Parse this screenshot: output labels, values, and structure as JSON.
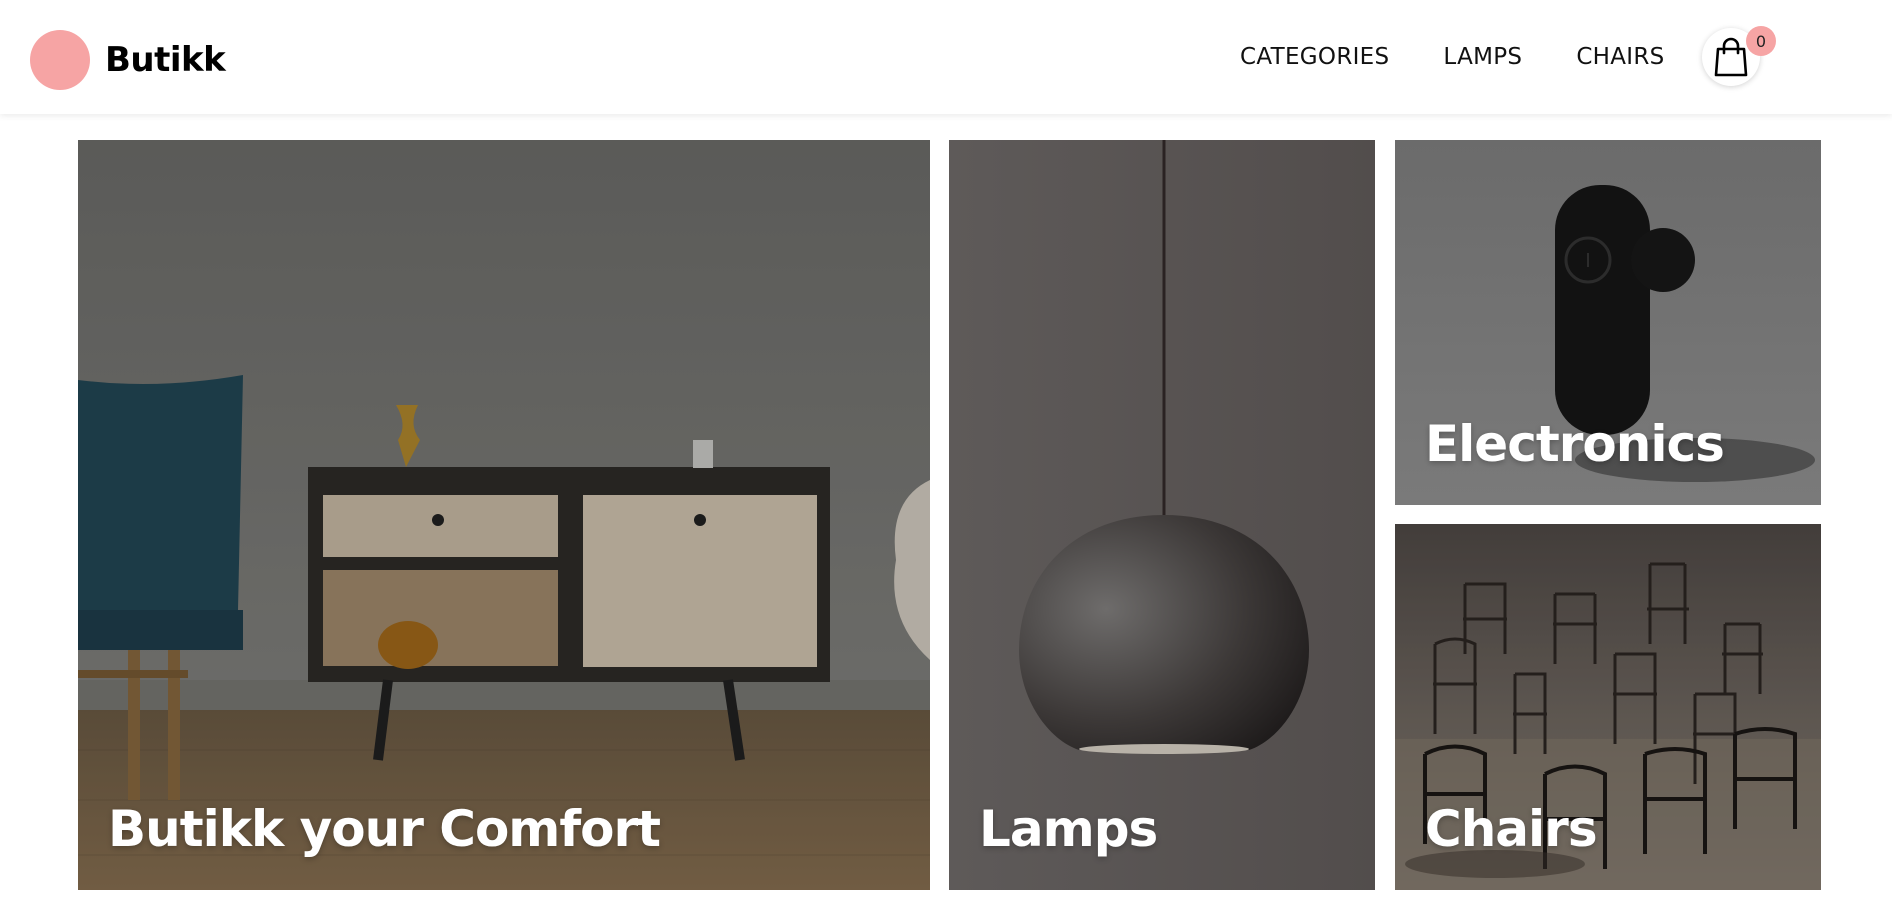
{
  "header": {
    "brand_name": "Butikk",
    "nav": [
      "CATEGORIES",
      "LAMPS",
      "CHAIRS"
    ],
    "cart_count": "0",
    "brand_color": "#f6a4a4"
  },
  "tiles": {
    "hero_title": "Butikk your Comfort",
    "lamps_title": "Lamps",
    "electronics_title": "Electronics",
    "chairs_title": "Chairs"
  },
  "icons": {
    "cart": "shopping-bag-icon"
  }
}
